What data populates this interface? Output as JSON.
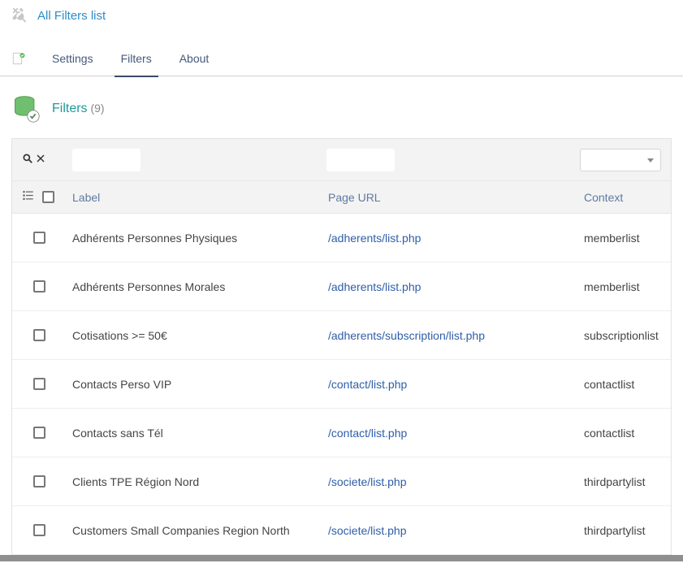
{
  "breadcrumb": {
    "title": "All Filters list"
  },
  "tabs": [
    {
      "label": "Settings",
      "active": false
    },
    {
      "label": "Filters",
      "active": true
    },
    {
      "label": "About",
      "active": false
    }
  ],
  "section": {
    "title": "Filters",
    "count": "(9)"
  },
  "columns": {
    "label": "Label",
    "url": "Page URL",
    "context": "Context"
  },
  "filters_input": {
    "label_value": "",
    "url_value": ""
  },
  "rows": [
    {
      "label": "Adhérents Personnes Physiques",
      "url": "/adherents/list.php",
      "context": "memberlist"
    },
    {
      "label": "Adhérents Personnes Morales",
      "url": "/adherents/list.php",
      "context": "memberlist"
    },
    {
      "label": "Cotisations >= 50€",
      "url": "/adherents/subscription/list.php",
      "context": "subscriptionlist"
    },
    {
      "label": "Contacts Perso VIP",
      "url": "/contact/list.php",
      "context": "contactlist"
    },
    {
      "label": "Contacts sans Tél",
      "url": "/contact/list.php",
      "context": "contactlist"
    },
    {
      "label": "Clients TPE Région Nord",
      "url": "/societe/list.php",
      "context": "thirdpartylist"
    },
    {
      "label": "Customers Small Companies Region North",
      "url": "/societe/list.php",
      "context": "thirdpartylist"
    }
  ]
}
